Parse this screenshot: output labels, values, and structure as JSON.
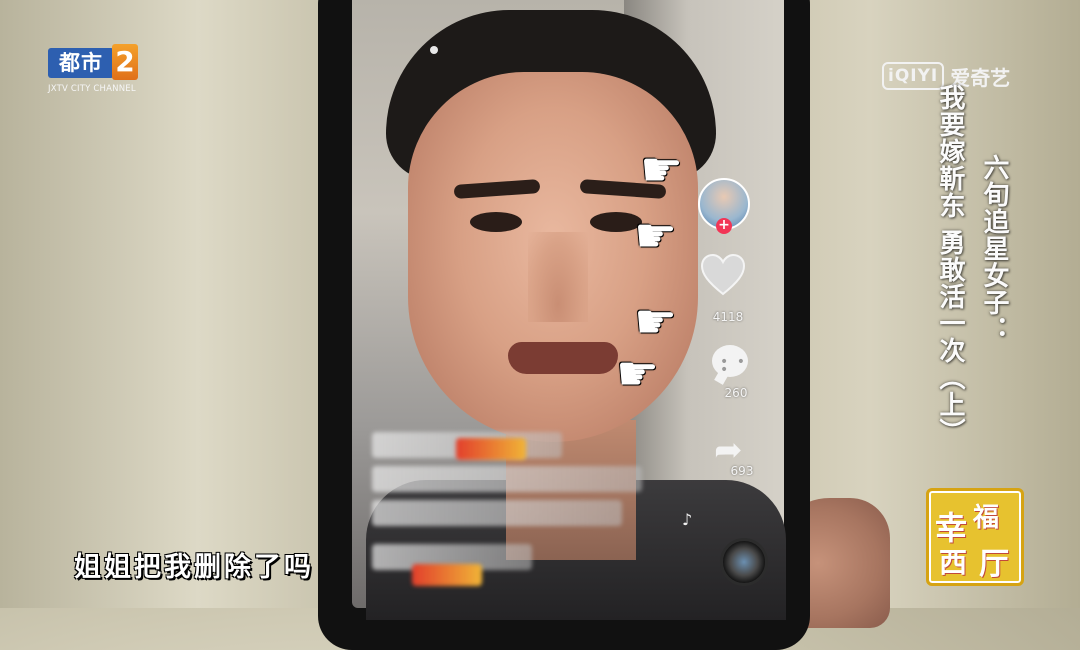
{
  "channel_logo": {
    "name": "都市",
    "number": "2",
    "subtitle": "JXTV CITY CHANNEL"
  },
  "watermark": {
    "brand_mark": "iQIYI",
    "brand_text": "爱奇艺"
  },
  "title": {
    "line1": "六旬追星女子：",
    "line2": "我要嫁靳东 勇敢活一次（上）"
  },
  "program_logo": {
    "chars": [
      "幸",
      "福",
      "西",
      "厅"
    ]
  },
  "phone_app": {
    "like_count": "4118",
    "comment_count": "260",
    "share_count": "693",
    "follow_symbol": "+"
  },
  "subtitle": "姐姐把我删除了吗",
  "colors": {
    "accent_follow": "#f23556",
    "logo_blue": "#2d5fb0",
    "logo_orange": "#f4a12b"
  },
  "icons": [
    "heart-icon",
    "comment-icon",
    "share-icon",
    "music-disc-icon",
    "pointing-hand-icon"
  ]
}
